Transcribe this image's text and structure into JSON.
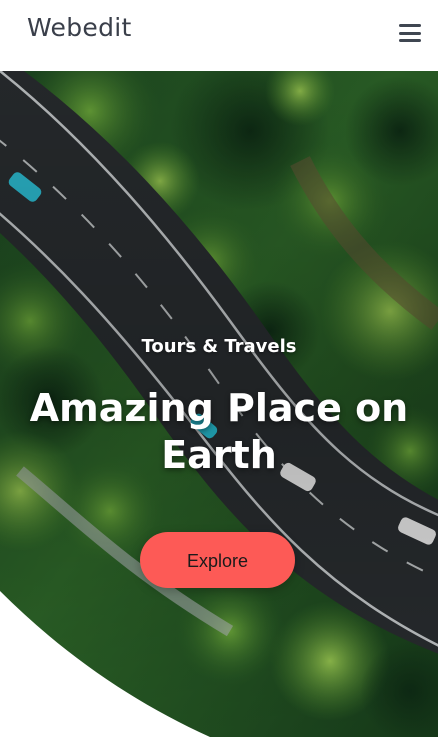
{
  "header": {
    "brand": "Webedit",
    "menu_icon": "hamburger-menu-icon"
  },
  "hero": {
    "subtitle": "Tours & Travels",
    "headline": "Amazing Place on Earth",
    "cta_label": "Explore",
    "background": "aerial-road-forest-image"
  },
  "colors": {
    "accent": "#fd5a56",
    "brand_text": "#3a3f4a",
    "forest_dark": "#123a1c",
    "forest_light": "#3e8a2c",
    "road": "#2b2f33"
  }
}
